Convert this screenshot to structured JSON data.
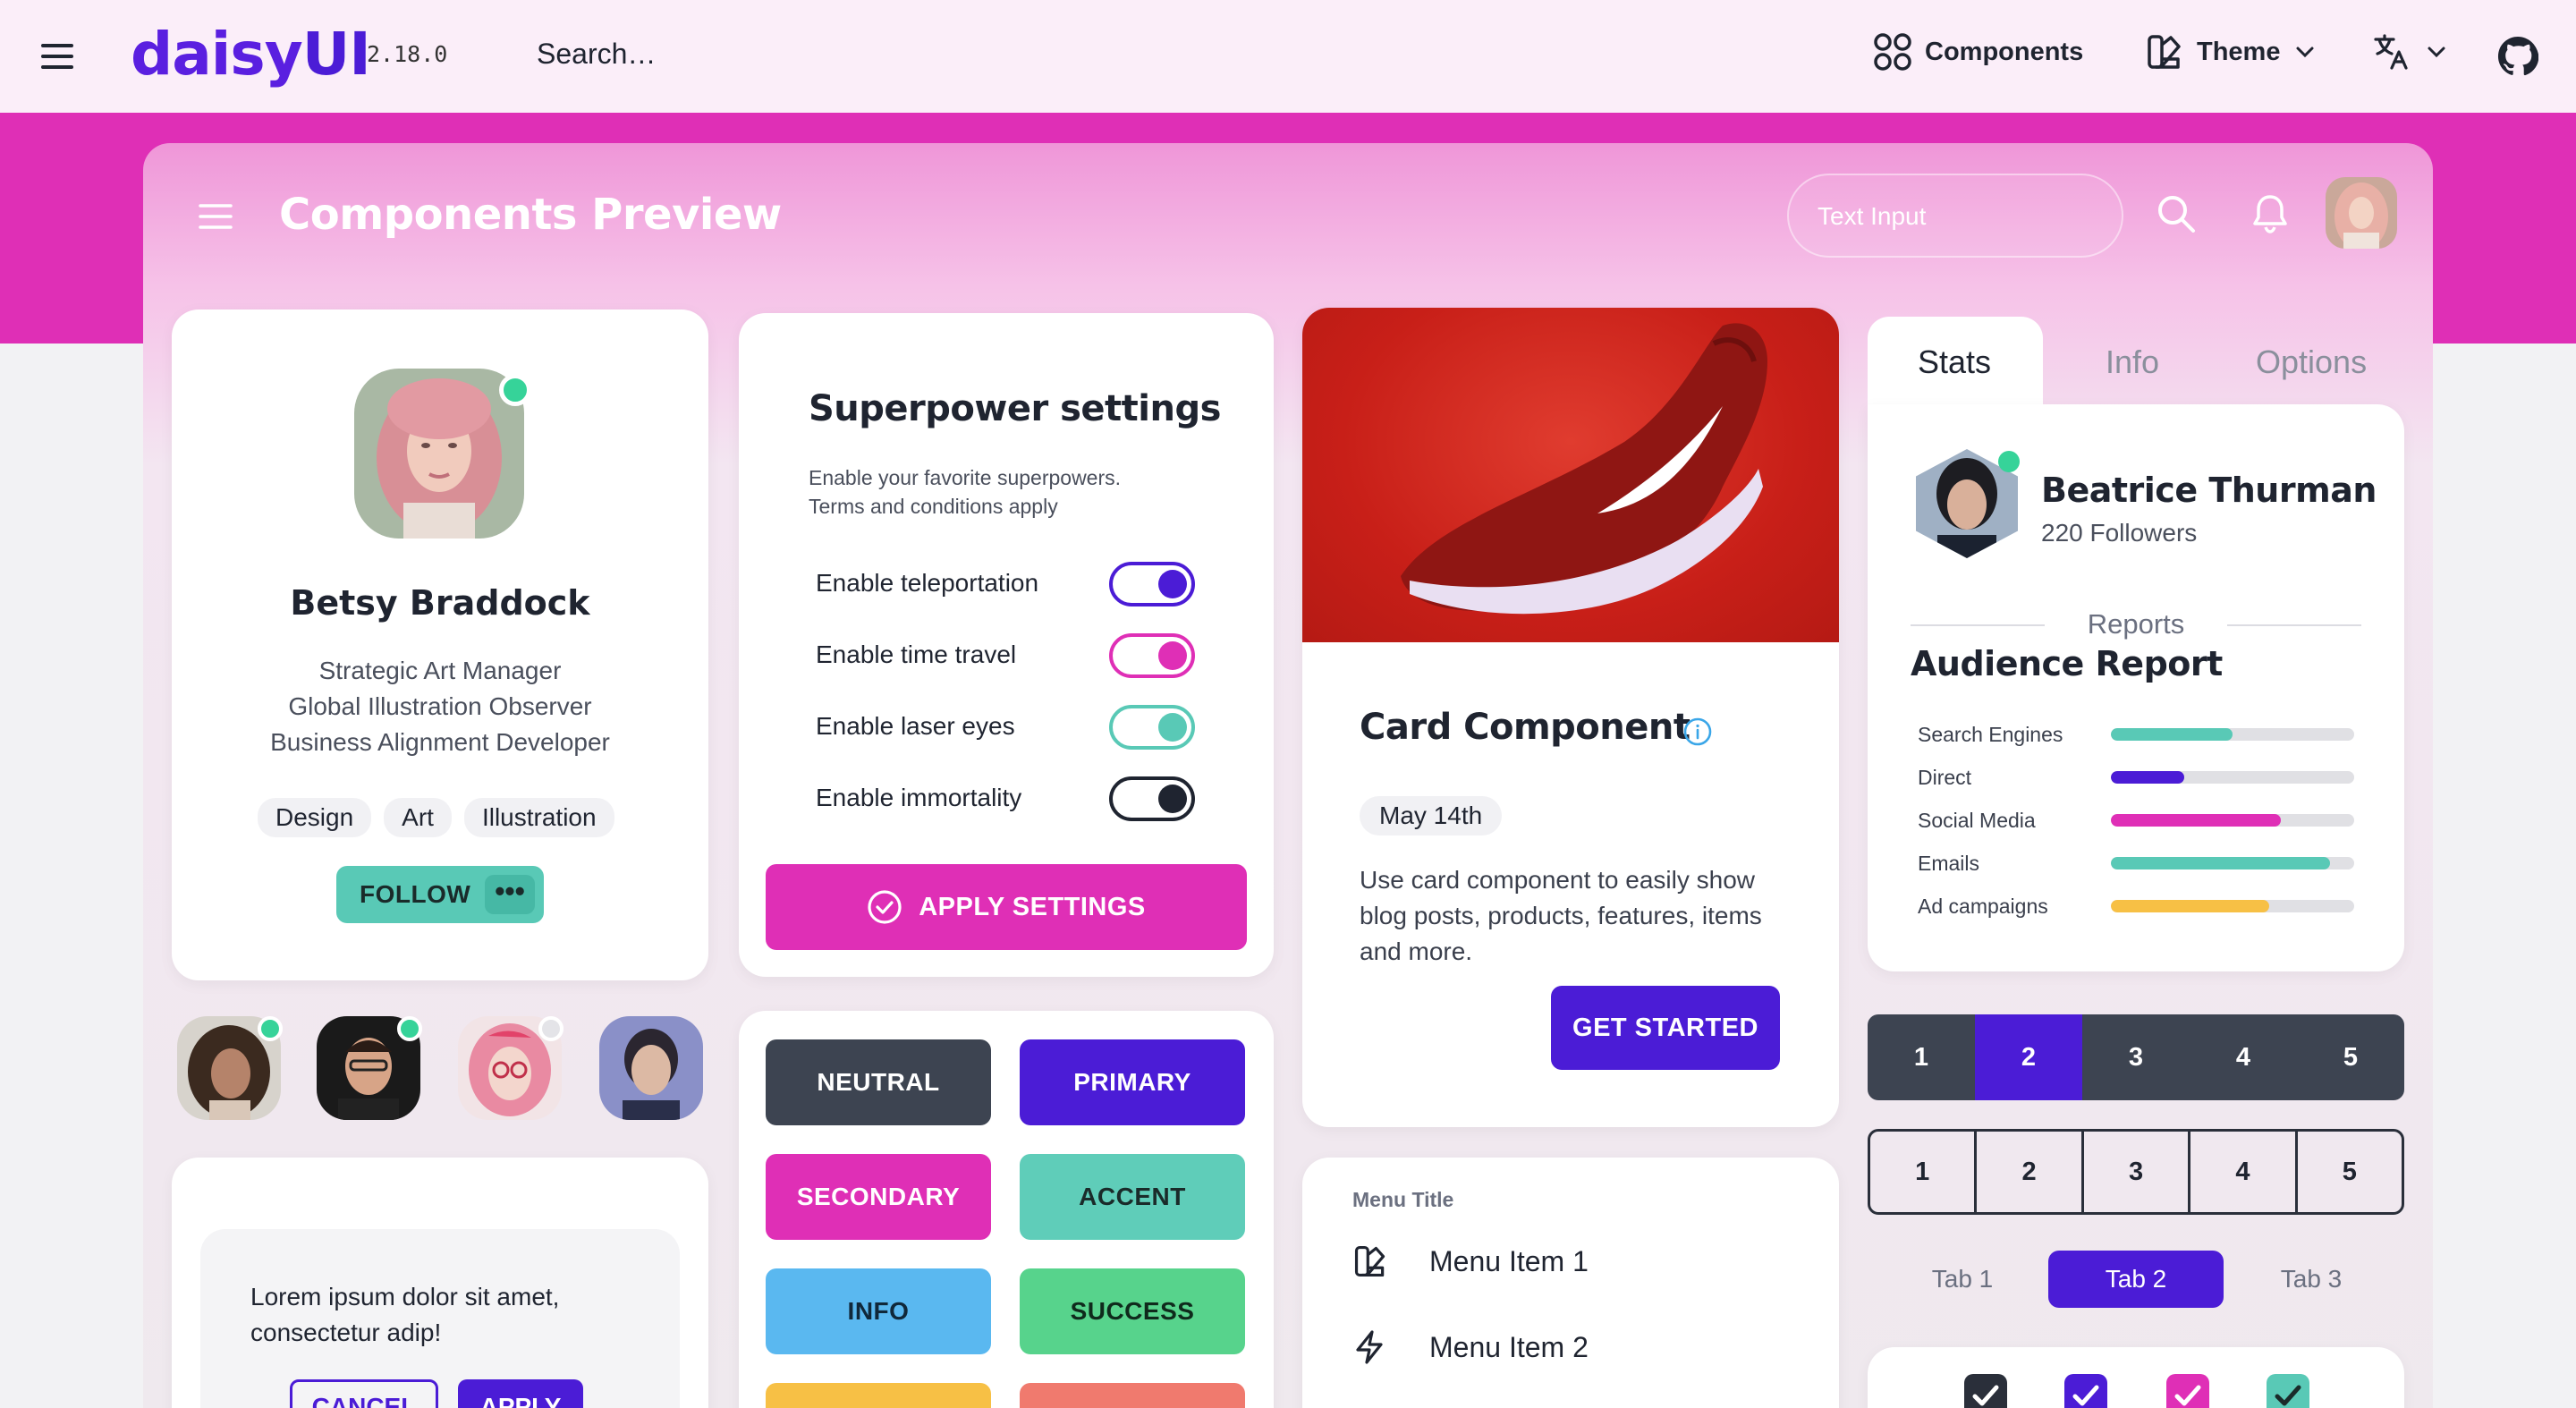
{
  "topbar": {
    "brand_main": "daisy",
    "brand_accent": "UI",
    "version": "2.18.0",
    "search_placeholder": "Search…",
    "components_label": "Components",
    "theme_label": "Theme"
  },
  "preview": {
    "title": "Components Preview",
    "text_input_placeholder": "Text Input"
  },
  "profile": {
    "name": "Betsy Braddock",
    "roles": [
      "Strategic Art Manager",
      "Global Illustration Observer",
      "Business Alignment Developer"
    ],
    "tags": [
      "Design",
      "Art",
      "Illustration"
    ],
    "follow_label": "FOLLOW",
    "more_label": "•••"
  },
  "lorem": {
    "text_line1": "Lorem ipsum dolor sit amet,",
    "text_line2": "consectetur adip!",
    "cancel_label": "CANCEL",
    "apply_label": "APPLY"
  },
  "superpower": {
    "title": "Superpower settings",
    "desc_line1": "Enable your favorite superpowers.",
    "desc_line2": "Terms and conditions apply",
    "rows": [
      {
        "label": "Enable teleportation",
        "color": "#4b1cd6",
        "on": true
      },
      {
        "label": "Enable time travel",
        "color": "#df2fb6",
        "on": true
      },
      {
        "label": "Enable laser eyes",
        "color": "#59c9b6",
        "on": true
      },
      {
        "label": "Enable immortality",
        "color": "#1f2430",
        "on": true
      }
    ],
    "apply_label": "APPLY SETTINGS"
  },
  "colors": {
    "buttons": [
      {
        "label": "NEUTRAL",
        "bg": "#3d4451",
        "fg": "#ffffff"
      },
      {
        "label": "PRIMARY",
        "bg": "#4b1cd6",
        "fg": "#ffffff"
      },
      {
        "label": "SECONDARY",
        "bg": "#df2fb6",
        "fg": "#ffffff"
      },
      {
        "label": "ACCENT",
        "bg": "#5fcdb9",
        "fg": "#1a2b2a"
      },
      {
        "label": "INFO",
        "bg": "#5ab8f0",
        "fg": "#10283a"
      },
      {
        "label": "SUCCESS",
        "bg": "#57d38c",
        "fg": "#0f2a1c"
      }
    ]
  },
  "product": {
    "title": "Card Component",
    "date": "May 14th",
    "text": "Use card component to easily show blog posts, products, features, items and more.",
    "cta_label": "GET STARTED"
  },
  "menu": {
    "title": "Menu Title",
    "item1": "Menu Item 1",
    "item2": "Menu Item 2"
  },
  "stats": {
    "tabs": [
      "Stats",
      "Info",
      "Options"
    ],
    "name": "Beatrice Thurman",
    "followers": "220 Followers",
    "reports_label": "Reports",
    "audience_title": "Audience Report",
    "rows": [
      {
        "label": "Search Engines",
        "value": 0.5,
        "color": "#59c9b6"
      },
      {
        "label": "Direct",
        "value": 0.3,
        "color": "#4b1cd6"
      },
      {
        "label": "Social Media",
        "value": 0.7,
        "color": "#df2fb6"
      },
      {
        "label": "Emails",
        "value": 0.9,
        "color": "#59c9b6"
      },
      {
        "label": "Ad campaigns",
        "value": 0.65,
        "color": "#f7c045"
      }
    ]
  },
  "pagination": {
    "pages": [
      "1",
      "2",
      "3",
      "4",
      "5"
    ],
    "active_page": "2"
  },
  "box_tabs": [
    "Tab 1",
    "Tab 2",
    "Tab 3"
  ],
  "checkboxes": [
    {
      "color": "#2a2f3a"
    },
    {
      "color": "#4b1cd6"
    },
    {
      "color": "#df2fb6"
    },
    {
      "color": "#59c9b6"
    }
  ]
}
